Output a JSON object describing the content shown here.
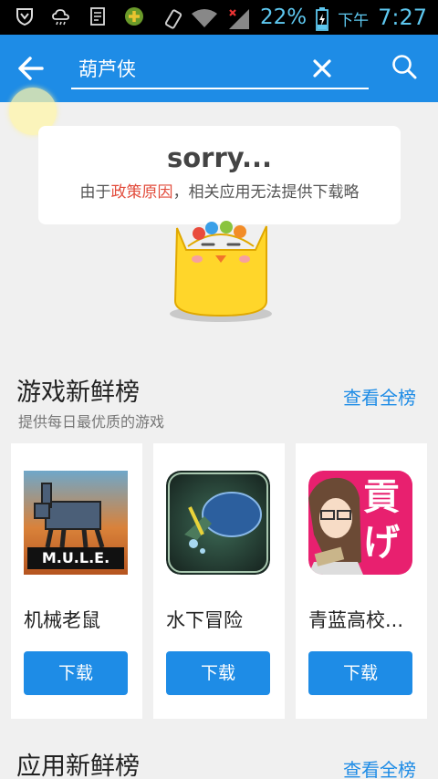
{
  "status_bar": {
    "battery_percent": "22%",
    "ampm": "下午",
    "time": "7:27"
  },
  "search": {
    "query": "葫芦侠"
  },
  "notice": {
    "title": "sorry...",
    "msg_prefix": "由于",
    "msg_highlight": "政策原因",
    "msg_suffix": "，相关应用无法提供下载略"
  },
  "game_section": {
    "title": "游戏新鲜榜",
    "subtitle": "提供每日最优质的游戏",
    "see_all": "查看全榜",
    "apps": [
      {
        "name": "机械老鼠",
        "icon_text": "M.U.L.E.",
        "button": "下载"
      },
      {
        "name": "水下冒险",
        "button": "下载"
      },
      {
        "name": "青蓝高校...",
        "icon_text": "貢げ",
        "button": "下载"
      }
    ]
  },
  "app_section": {
    "title": "应用新鲜榜",
    "see_all": "查看全榜"
  },
  "colors": {
    "primary": "#1e8ce6",
    "highlight": "#e24c3c",
    "background": "#f0f0f0"
  }
}
